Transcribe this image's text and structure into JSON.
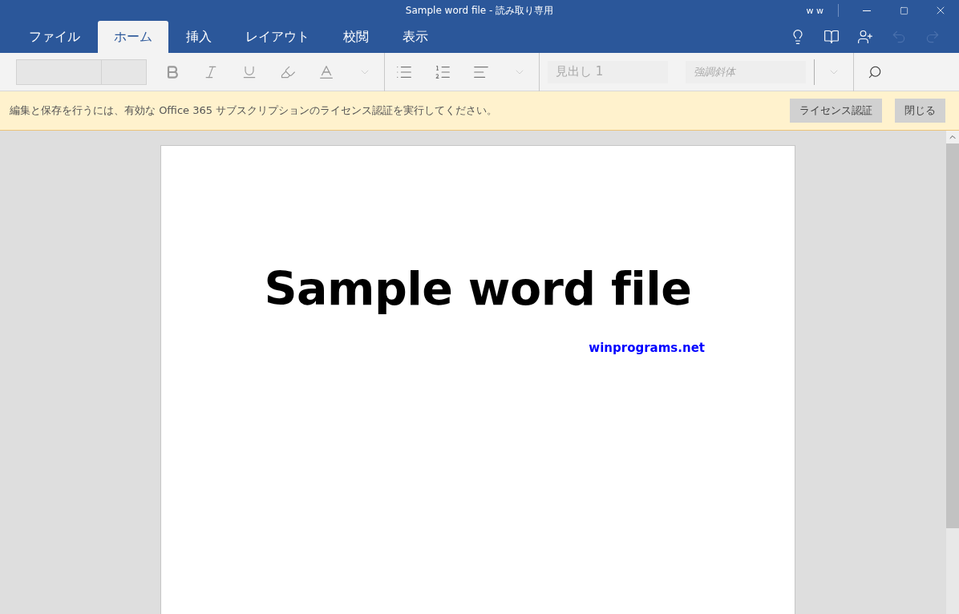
{
  "title_bar": {
    "title": "Sample word file - 読み取り専用",
    "user": "w w"
  },
  "tabs": [
    {
      "label": "ファイル",
      "selected": false
    },
    {
      "label": "ホーム",
      "selected": true
    },
    {
      "label": "挿入",
      "selected": false
    },
    {
      "label": "レイアウト",
      "selected": false
    },
    {
      "label": "校閲",
      "selected": false
    },
    {
      "label": "表示",
      "selected": false
    }
  ],
  "toolbar": {
    "styles": [
      {
        "label": "見出し 1",
        "italic": false
      },
      {
        "label": "強調斜体",
        "italic": true
      }
    ]
  },
  "banner": {
    "message": "編集と保存を行うには、有効な Office 365 サブスクリプションのライセンス認証を実行してください。",
    "buttons": [
      "ライセンス認証",
      "閉じる"
    ]
  },
  "document": {
    "heading": "Sample word file",
    "link": "winprograms.net"
  }
}
